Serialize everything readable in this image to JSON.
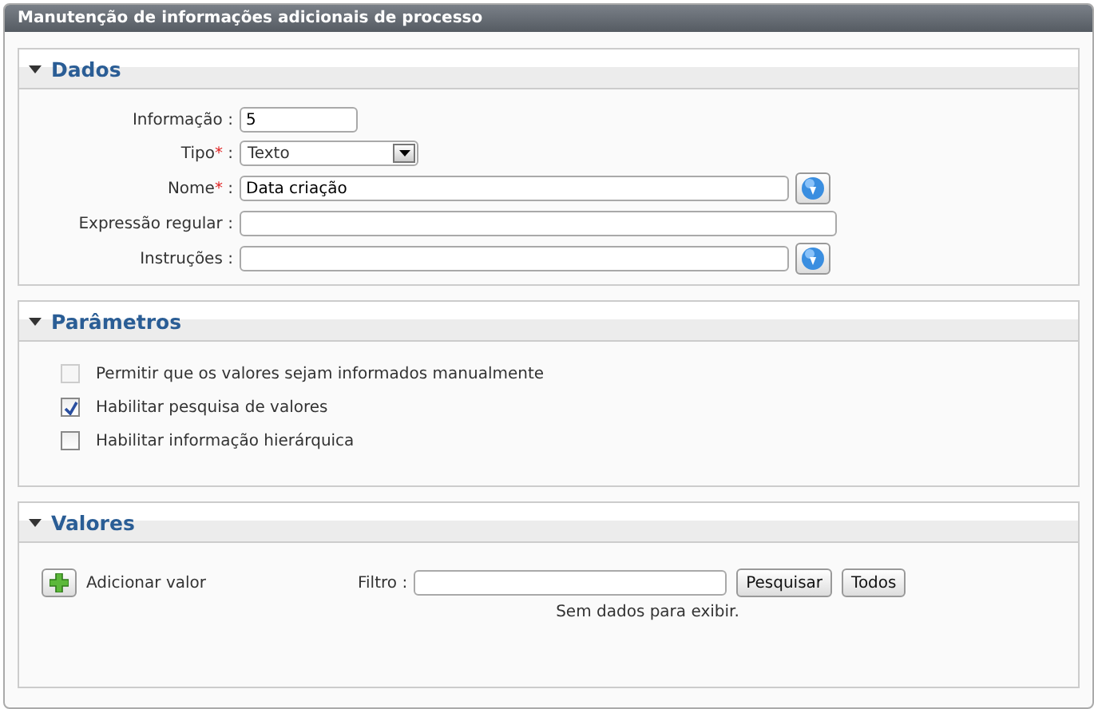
{
  "window": {
    "title": "Manutenção de informações adicionais de processo"
  },
  "required_mark": "*",
  "label_separator": ":",
  "dados": {
    "title": "Dados",
    "expanded": true,
    "fields": [
      {
        "label": "Informação",
        "required": false,
        "kind": "text",
        "value": "5",
        "lookup": false
      },
      {
        "label": "Tipo",
        "required": true,
        "kind": "select",
        "value": "Texto",
        "lookup": false
      },
      {
        "label": "Nome",
        "required": true,
        "kind": "text",
        "value": "Data criação",
        "lookup": true
      },
      {
        "label": "Expressão regular",
        "required": false,
        "kind": "text",
        "lookup": false
      },
      {
        "label": "Instruções",
        "required": false,
        "kind": "text",
        "lookup": true
      }
    ]
  },
  "parametros": {
    "title": "Parâmetros",
    "expanded": true,
    "options": [
      {
        "label": "Permitir que os valores sejam informados manualmente",
        "checked": false,
        "disabled": true
      },
      {
        "label": "Habilitar pesquisa de valores",
        "checked": true,
        "disabled": false
      },
      {
        "label": "Habilitar informação hierárquica",
        "checked": false,
        "disabled": false
      }
    ]
  },
  "valores": {
    "title": "Valores",
    "expanded": true,
    "add_label": "Adicionar valor",
    "filter_label": "Filtro",
    "buttons": [
      "Pesquisar",
      "Todos"
    ],
    "empty_message": "Sem dados para exibir."
  }
}
